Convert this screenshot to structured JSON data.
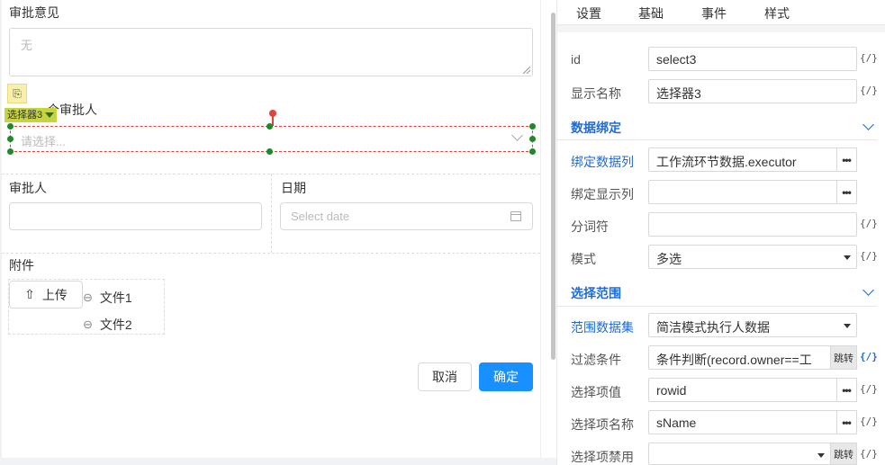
{
  "form": {
    "opinion_label": "审批意见",
    "opinion_placeholder": "无",
    "next_approver_label": "一个审批人",
    "selector_tag": "选择器3",
    "select_placeholder": "请选择...",
    "approver_label": "审批人",
    "date_label": "日期",
    "date_placeholder": "Select date",
    "attachment_label": "附件",
    "upload_label": "上传",
    "files": [
      "文件1",
      "文件2"
    ],
    "cancel_label": "取消",
    "ok_label": "确定"
  },
  "panel": {
    "tabs": [
      "设置",
      "基础",
      "事件",
      "样式"
    ],
    "fx_label": "{/}",
    "dots_label": "•••",
    "jump_label": "跳转",
    "rows": {
      "id": {
        "label": "id",
        "value": "select3"
      },
      "display_name": {
        "label": "显示名称",
        "value": "选择器3"
      },
      "bind_column": {
        "label": "绑定数据列",
        "value": "工作流环节数据.executor"
      },
      "bind_display": {
        "label": "绑定显示列",
        "value": ""
      },
      "separator": {
        "label": "分词符",
        "value": ""
      },
      "mode": {
        "label": "模式",
        "value": "多选"
      },
      "range_dataset": {
        "label": "范围数据集",
        "value": "简洁模式执行人数据"
      },
      "filter": {
        "label": "过滤条件",
        "value": "条件判断(record.owner==工"
      },
      "option_value": {
        "label": "选择项值",
        "value": "rowid"
      },
      "option_name": {
        "label": "选择项名称",
        "value": "sName"
      },
      "option_disabled": {
        "label": "选择项禁用",
        "value": ""
      }
    },
    "sections": {
      "data_binding": "数据绑定",
      "select_range": "选择范围"
    }
  }
}
